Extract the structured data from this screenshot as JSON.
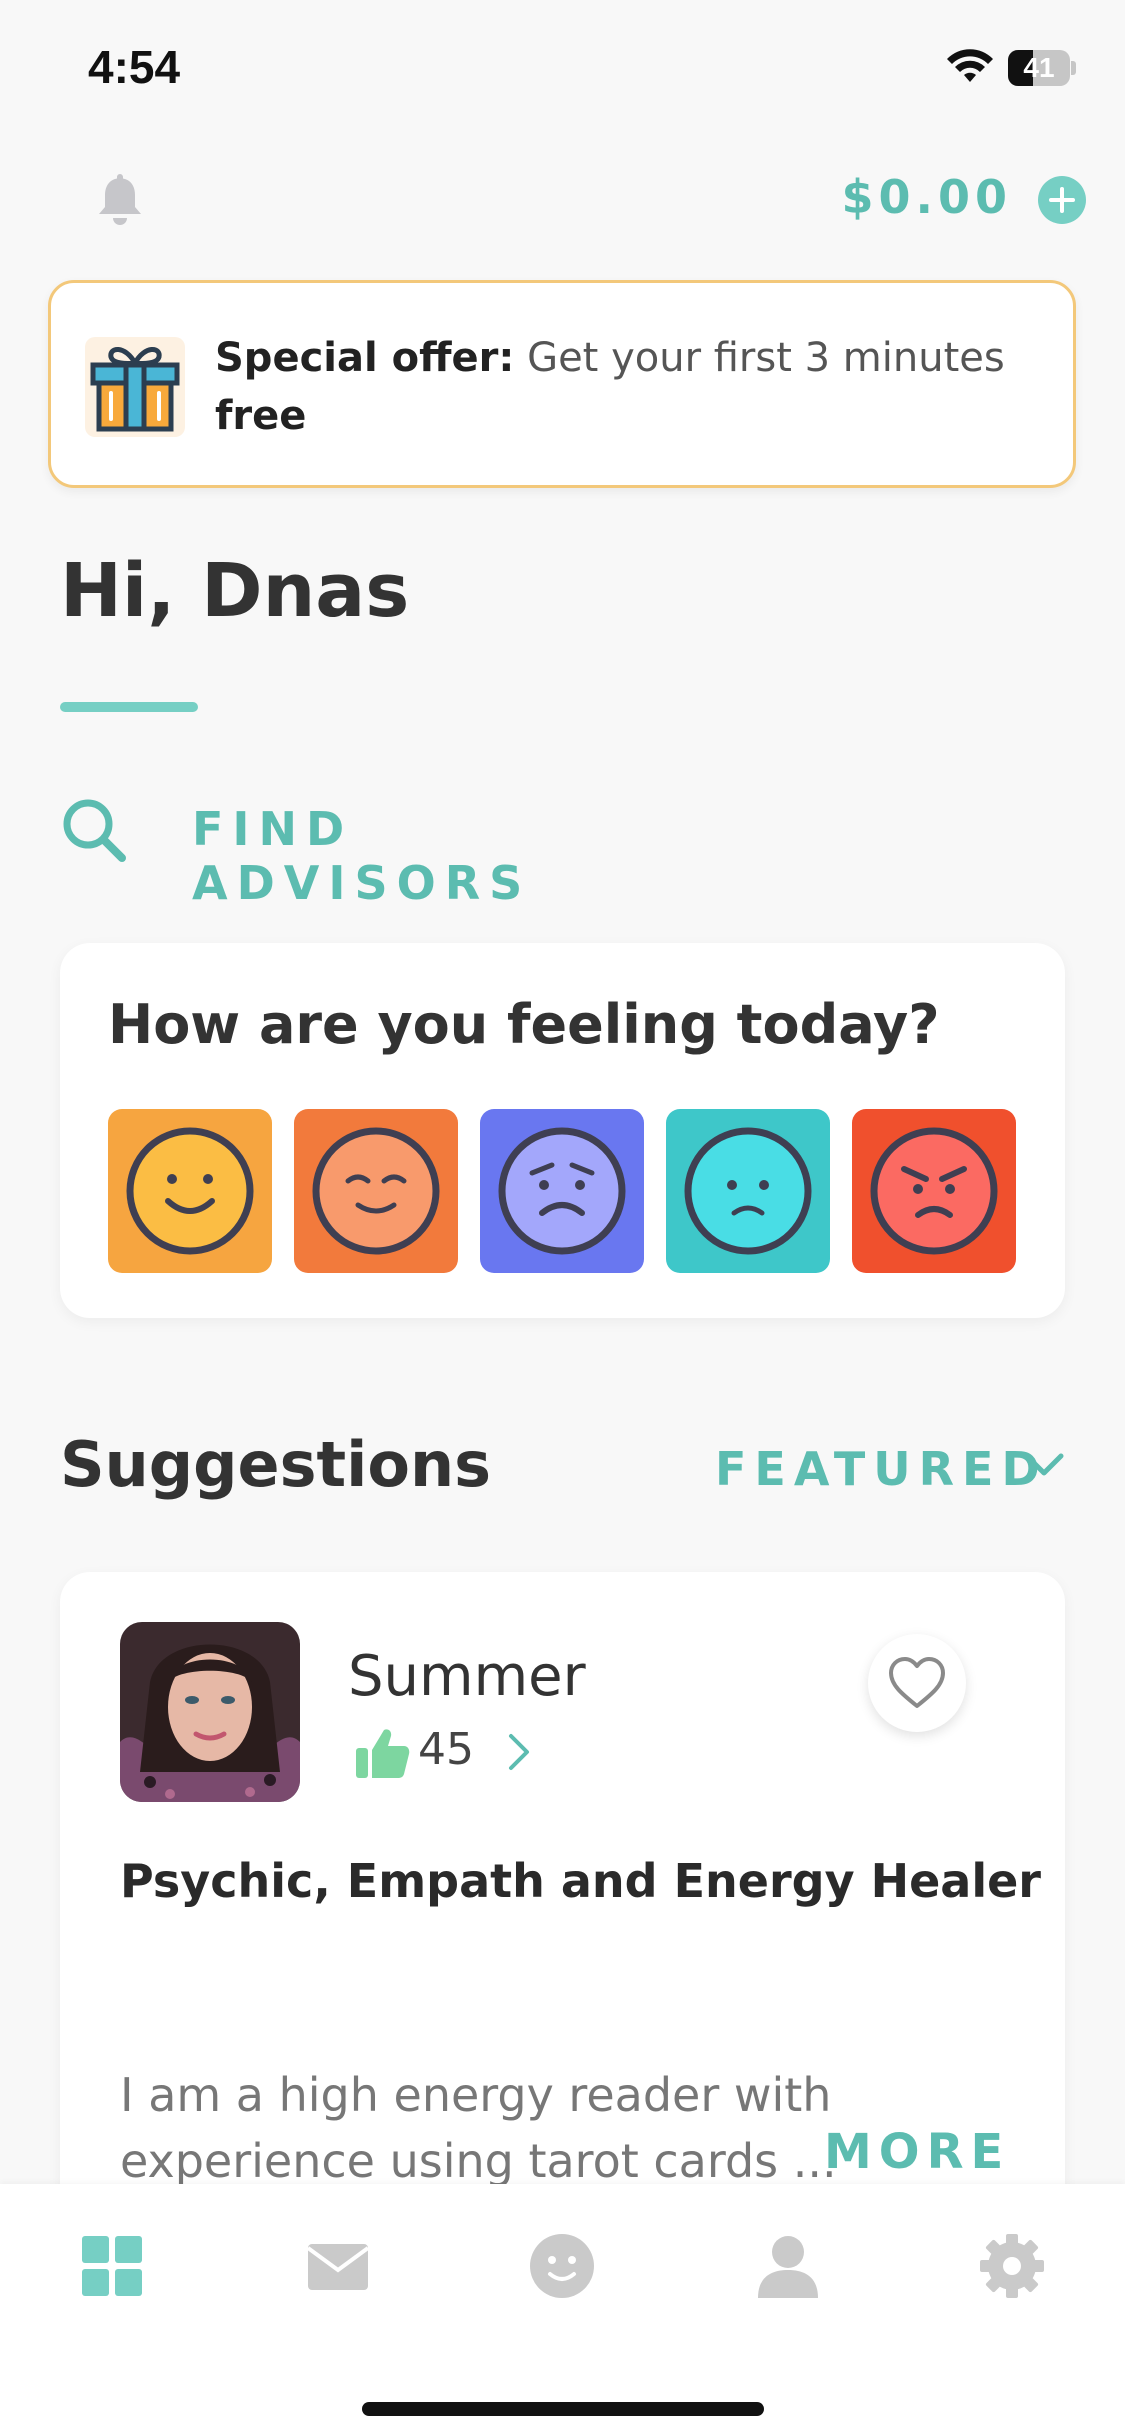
{
  "status_bar": {
    "time": "4:54",
    "battery_level": 41,
    "battery_text": "41"
  },
  "header": {
    "balance": "$0.00"
  },
  "offer": {
    "bold_label": "Special offer:",
    "text": "Get your first 3 minutes",
    "bold_suffix": "free"
  },
  "greeting": "Hi, Dnas",
  "find_advisors": "FIND ADVISORS",
  "mood": {
    "title": "How are you feeling today?",
    "options": [
      {
        "name": "happy",
        "color": "#f6a540"
      },
      {
        "name": "content",
        "color": "#f27a3c"
      },
      {
        "name": "worried",
        "color": "#6977f0"
      },
      {
        "name": "sad",
        "color": "#3ec7c9"
      },
      {
        "name": "angry",
        "color": "#f0502d"
      }
    ]
  },
  "suggestions": {
    "title": "Suggestions",
    "filter": "FEATURED",
    "advisor": {
      "name": "Summer",
      "rating": "45",
      "title": "Psychic, Empath and Energy Healer",
      "bio_line1": "I am a high energy reader with",
      "bio_line2": "experience using tarot cards ...",
      "more": "MORE"
    }
  },
  "tab_bar": {
    "items": [
      {
        "name": "dashboard-icon",
        "active": true
      },
      {
        "name": "mail-icon",
        "active": false
      },
      {
        "name": "mood-icon",
        "active": false
      },
      {
        "name": "profile-icon",
        "active": false
      },
      {
        "name": "settings-icon",
        "active": false
      }
    ]
  },
  "colors": {
    "accent": "#5cbcb0",
    "accent_light": "#76cfc4",
    "offer_border": "#f3c87a",
    "inactive_icon": "#c9c9c9"
  }
}
